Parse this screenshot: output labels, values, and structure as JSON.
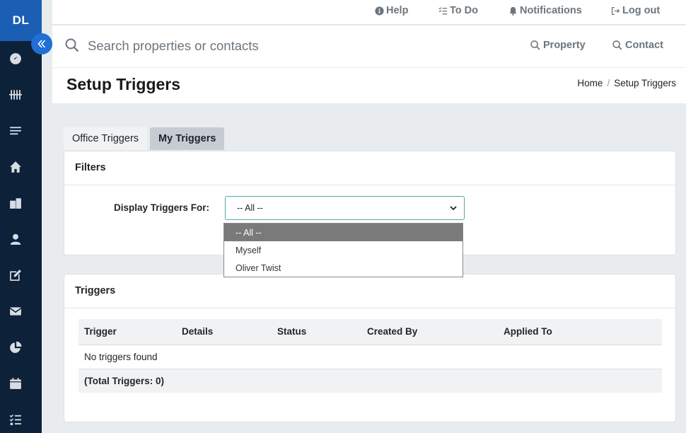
{
  "app": {
    "logo": "DL"
  },
  "topnav": {
    "help": "Help",
    "todo": "To Do",
    "notifications": "Notifications",
    "logout": "Log out"
  },
  "search": {
    "placeholder": "Search properties or contacts",
    "property": "Property",
    "contact": "Contact"
  },
  "page": {
    "title": "Setup Triggers",
    "breadcrumb": {
      "home": "Home",
      "current": "Setup Triggers"
    }
  },
  "tabs": [
    {
      "label": "Office Triggers",
      "active": false
    },
    {
      "label": "My Triggers",
      "active": true
    }
  ],
  "filters": {
    "title": "Filters",
    "label": "Display Triggers For:",
    "selected": "-- All --",
    "options": [
      "-- All --",
      "Myself",
      "Oliver Twist"
    ]
  },
  "triggers": {
    "title": "Triggers",
    "columns": [
      "Trigger",
      "Details",
      "Status",
      "Created By",
      "Applied To"
    ],
    "empty": "No triggers found",
    "total": "(Total Triggers: 0)"
  },
  "colors": {
    "sidebar": "#0d2138",
    "logo_bg": "#1a5fb4",
    "accent": "#1f6fd6",
    "select_border": "#52a6a3"
  }
}
